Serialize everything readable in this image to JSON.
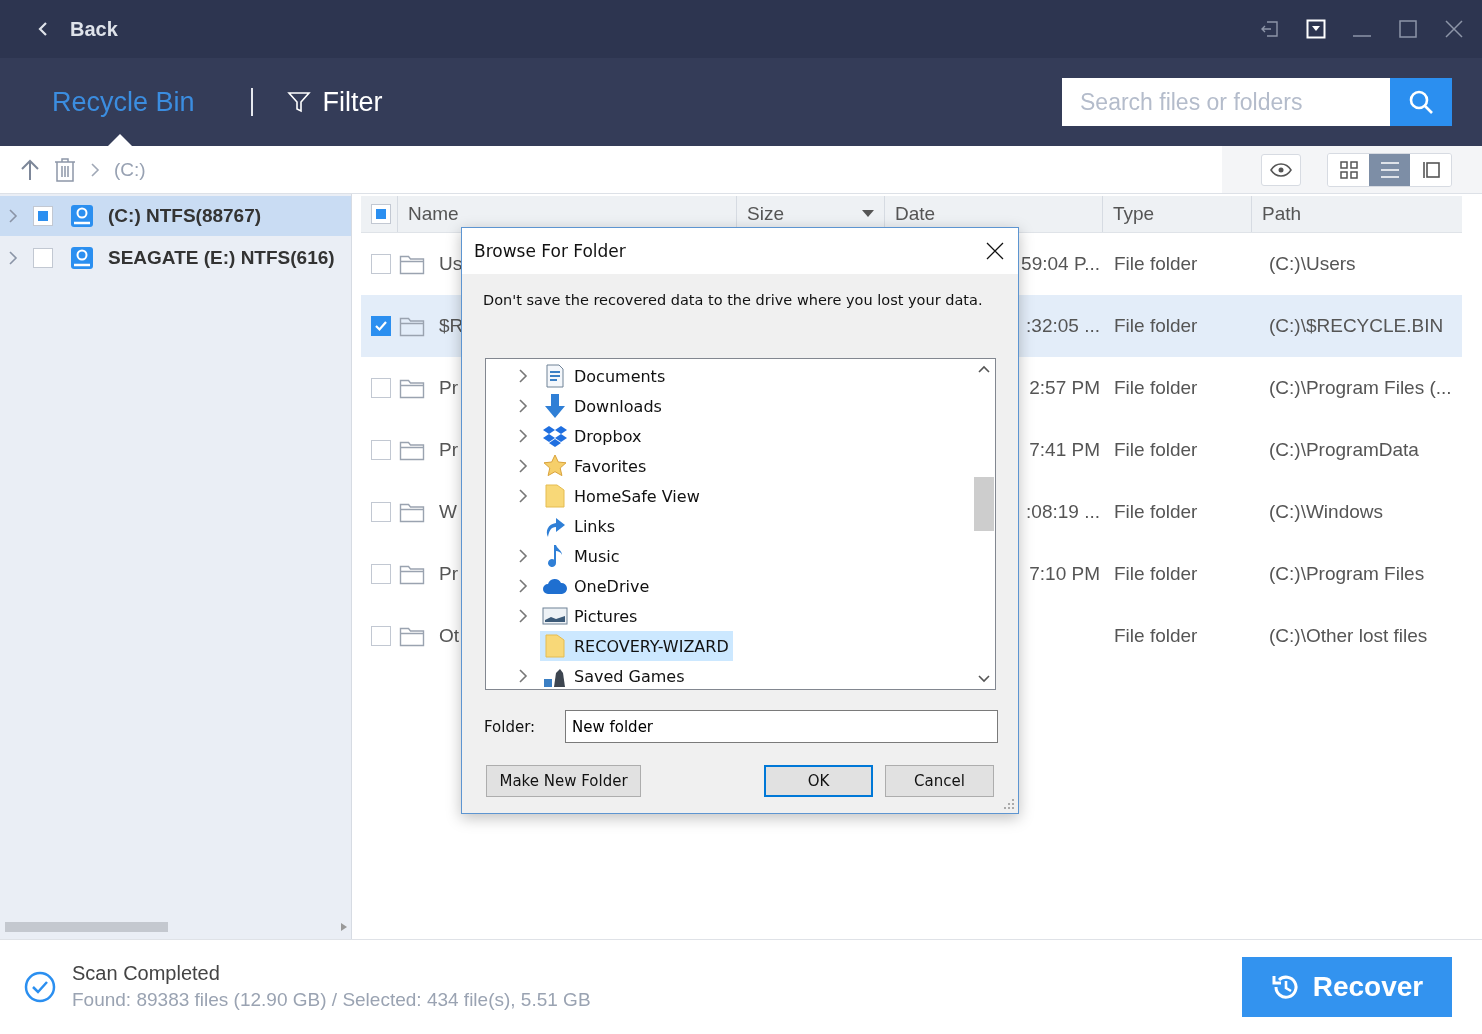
{
  "topbar": {
    "back": "Back"
  },
  "header": {
    "tabs": [
      {
        "label": "Recycle Bin",
        "kind": "location",
        "selected": true
      },
      {
        "label": "Filter",
        "kind": "filter",
        "selected": false
      }
    ],
    "search": {
      "placeholder": "Search files or folders"
    }
  },
  "toolbar": {
    "breadcrumb": "(C:)",
    "view_modes": [
      {
        "kind": "grid",
        "selected": false
      },
      {
        "kind": "list",
        "selected": true
      },
      {
        "kind": "panel",
        "selected": false
      }
    ]
  },
  "drives": [
    {
      "label": "(C:) NTFS(88767)",
      "checked": false,
      "partial": true,
      "selected": true
    },
    {
      "label": "SEAGATE (E:) NTFS(616)",
      "checked": false,
      "partial": false,
      "selected": false
    }
  ],
  "table": {
    "all_checked": false,
    "all_partial": true,
    "columns": [
      {
        "label": "Name",
        "sorted": false
      },
      {
        "label": "Size",
        "sorted": true
      },
      {
        "label": "Date",
        "sorted": false
      },
      {
        "label": "Type",
        "sorted": false
      },
      {
        "label": "Path",
        "sorted": false
      }
    ],
    "rows": [
      {
        "name": "Us",
        "date": "59:04 P...",
        "type": "File folder",
        "path": "(C:)\\Users",
        "checked": false,
        "selected": false
      },
      {
        "name": "$R",
        "date": ":32:05 ...",
        "type": "File folder",
        "path": "(C:)\\$RECYCLE.BIN",
        "checked": true,
        "selected": true
      },
      {
        "name": "Pr",
        "date": "2:57 PM",
        "type": "File folder",
        "path": "(C:)\\Program Files (...",
        "checked": false,
        "selected": false
      },
      {
        "name": "Pr",
        "date": "7:41 PM",
        "type": "File folder",
        "path": "(C:)\\ProgramData",
        "checked": false,
        "selected": false
      },
      {
        "name": "W",
        "date": ":08:19 ...",
        "type": "File folder",
        "path": "(C:)\\Windows",
        "checked": false,
        "selected": false
      },
      {
        "name": "Pr",
        "date": "7:10 PM",
        "type": "File folder",
        "path": "(C:)\\Program Files",
        "checked": false,
        "selected": false
      },
      {
        "name": "Ot",
        "type": "File folder",
        "path": "(C:)\\Other lost files",
        "checked": false,
        "selected": false
      }
    ]
  },
  "dialog": {
    "title": "Browse For Folder",
    "message": "Don't save the recovered data to the drive where you lost your data.",
    "tree": [
      {
        "label": "Documents",
        "kind": "documents",
        "expandable": true,
        "selected": false
      },
      {
        "label": "Downloads",
        "kind": "downloads",
        "expandable": true,
        "selected": false
      },
      {
        "label": "Dropbox",
        "kind": "dropbox",
        "expandable": true,
        "selected": false
      },
      {
        "label": "Favorites",
        "kind": "favorites",
        "expandable": true,
        "selected": false
      },
      {
        "label": "HomeSafe View",
        "kind": "folder",
        "expandable": true,
        "selected": false
      },
      {
        "label": "Links",
        "kind": "links",
        "expandable": false,
        "selected": false
      },
      {
        "label": "Music",
        "kind": "music",
        "expandable": true,
        "selected": false
      },
      {
        "label": "OneDrive",
        "kind": "cloud",
        "expandable": true,
        "selected": false
      },
      {
        "label": "Pictures",
        "kind": "pictures",
        "expandable": true,
        "selected": false
      },
      {
        "label": "RECOVERY-WIZARD",
        "kind": "folder",
        "expandable": false,
        "selected": true
      },
      {
        "label": "Saved Games",
        "kind": "games",
        "expandable": true,
        "selected": false
      }
    ],
    "folder_label": "Folder:",
    "folder_value": "New folder",
    "buttons": [
      {
        "label": "Make New Folder",
        "default": false
      },
      {
        "label": "OK",
        "default": true
      },
      {
        "label": "Cancel",
        "default": false
      }
    ]
  },
  "status": {
    "title": "Scan Completed",
    "detail": "Found: 89383 files (12.90 GB) / Selected: 434 file(s), 5.51 GB",
    "action": "Recover"
  }
}
